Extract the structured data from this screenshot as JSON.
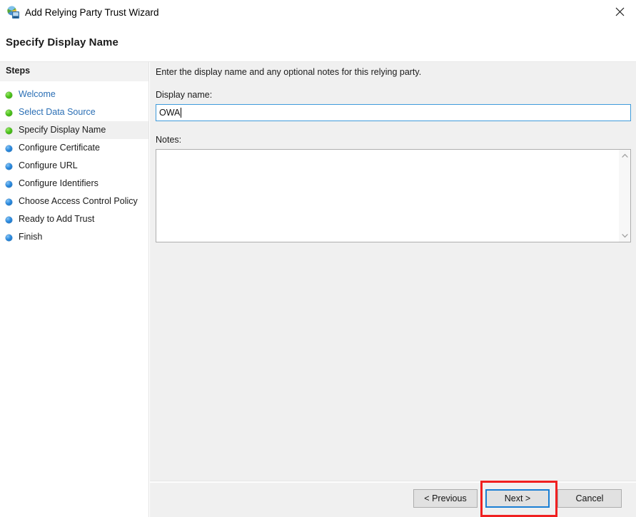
{
  "window": {
    "title": "Add Relying Party Trust Wizard",
    "icon": "wizard-globe-icon",
    "close_label": "✕"
  },
  "page": {
    "heading": "Specify Display Name"
  },
  "sidebar": {
    "header": "Steps",
    "items": [
      {
        "label": "Welcome",
        "state": "done",
        "bullet": "green"
      },
      {
        "label": "Select Data Source",
        "state": "done",
        "bullet": "green"
      },
      {
        "label": "Specify Display Name",
        "state": "current",
        "bullet": "green"
      },
      {
        "label": "Configure Certificate",
        "state": "pending",
        "bullet": "blue"
      },
      {
        "label": "Configure URL",
        "state": "pending",
        "bullet": "blue"
      },
      {
        "label": "Configure Identifiers",
        "state": "pending",
        "bullet": "blue"
      },
      {
        "label": "Choose Access Control Policy",
        "state": "pending",
        "bullet": "blue"
      },
      {
        "label": "Ready to Add Trust",
        "state": "pending",
        "bullet": "blue"
      },
      {
        "label": "Finish",
        "state": "pending",
        "bullet": "blue"
      }
    ]
  },
  "main": {
    "intro": "Enter the display name and any optional notes for this relying party.",
    "display_name": {
      "label": "Display name:",
      "value": "OWA",
      "placeholder": ""
    },
    "notes": {
      "label": "Notes:",
      "value": "",
      "placeholder": ""
    },
    "scrollbar": {
      "up_icon": "chevron-up-icon",
      "down_icon": "chevron-down-icon"
    }
  },
  "footer": {
    "previous_label": "< Previous",
    "next_label": "Next >",
    "cancel_label": "Cancel"
  },
  "colors": {
    "focus_blue": "#1a7fd4",
    "annotation_red": "#f02020",
    "link_blue": "#2b6fb5",
    "panel_gray": "#f0f0f0",
    "button_gray": "#e1e1e1"
  }
}
